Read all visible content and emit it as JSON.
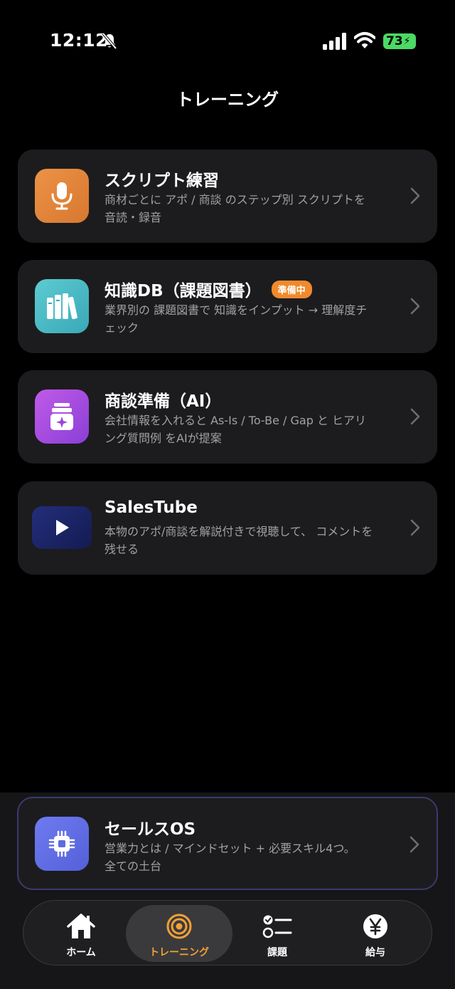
{
  "status_bar": {
    "time": "12:12",
    "battery": "73"
  },
  "page": {
    "title": "トレーニング"
  },
  "cards": [
    {
      "title": "スクリプト練習",
      "badge": "",
      "description": "商材ごとに アポ / 商談 のステップ別 スクリプトを 音読・録音",
      "icon": "microphone-icon",
      "color": "#e0843a"
    },
    {
      "title": "知識DB（課題図書）",
      "badge": "準備中",
      "description": "業界別の 課題図書で 知識をインプット → 理解度チェック",
      "icon": "books-icon",
      "color": "#4bb8c4"
    },
    {
      "title": "商談準備（AI）",
      "badge": "",
      "description": "会社情報を入れると As-Is / To-Be / Gap と ヒアリング質問例 をAIが提案",
      "icon": "ai-box-icon",
      "color": "#a34be0"
    },
    {
      "title": "SalesTube",
      "badge": "",
      "description": "本物のアポ/商談を解説付きで視聴して、 コメントを残せる",
      "icon": "play-icon",
      "color": "#1b2466"
    }
  ],
  "os_card": {
    "title": "セールスOS",
    "description": "営業力とは / マインドセット + 必要スキル4つ。 全ての土台",
    "icon": "chip-icon"
  },
  "tabs": [
    {
      "label": "ホーム",
      "icon": "home-icon",
      "active": false
    },
    {
      "label": "トレーニング",
      "icon": "target-icon",
      "active": true
    },
    {
      "label": "課題",
      "icon": "checklist-icon",
      "active": false
    },
    {
      "label": "給与",
      "icon": "yen-icon",
      "active": false
    }
  ],
  "colors": {
    "accent": "#f2a137",
    "badge": "#f08a2c",
    "card_bg": "#1c1c1e",
    "background": "#000000"
  }
}
